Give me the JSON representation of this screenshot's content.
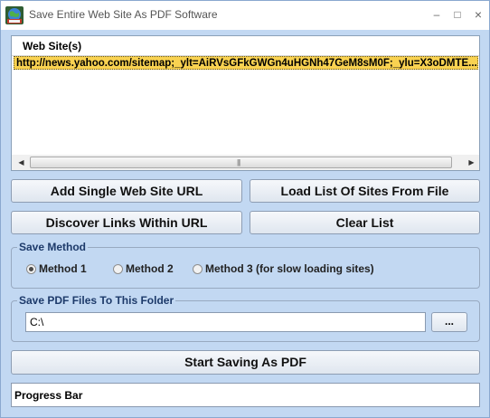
{
  "window": {
    "title": "Save Entire Web Site As PDF Software",
    "minimize_glyph": "–",
    "maximize_glyph": "□",
    "close_glyph": "×"
  },
  "sites_list": {
    "header": "Web Site(s)",
    "rows": [
      "http://news.yahoo.com/sitemap;_ylt=AiRVsGFkGWGn4uHGNh47GeM8sM0F;_ylu=X3oDMTE..."
    ],
    "scroll_left_glyph": "◀",
    "scroll_right_glyph": "▶",
    "scroll_grip": "|||"
  },
  "buttons": {
    "add_single": "Add Single Web Site URL",
    "load_list": "Load List Of Sites From File",
    "discover_links": "Discover Links Within URL",
    "clear_list": "Clear List",
    "start_saving": "Start Saving As PDF",
    "browse": "..."
  },
  "save_method": {
    "label": "Save Method",
    "options": [
      "Method 1",
      "Method 2",
      "Method 3 (for slow loading sites)"
    ],
    "selected": "Method 1"
  },
  "save_folder": {
    "label": "Save PDF Files To This Folder",
    "value": "C:\\"
  },
  "progress": {
    "label": "Progress Bar"
  }
}
